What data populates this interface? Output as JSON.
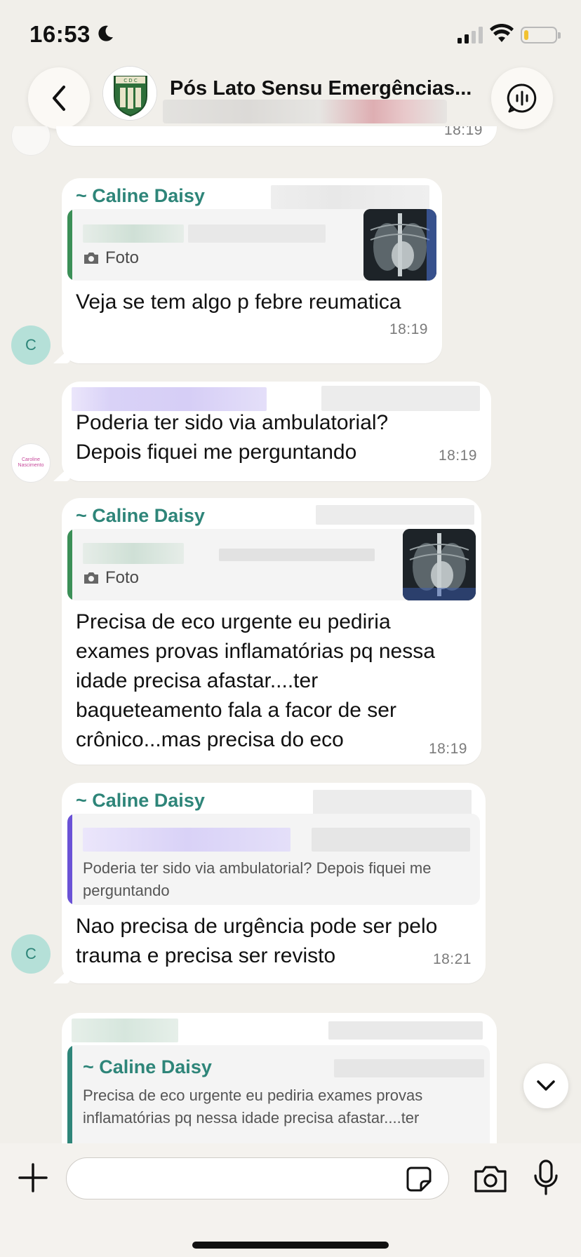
{
  "status_bar": {
    "time": "16:53"
  },
  "header": {
    "title": "Pós Lato Sensu Emergências..."
  },
  "chat": {
    "prev_time": "18:19",
    "messages": [
      {
        "sender": "~ Caline Daisy",
        "quote_label": "Foto",
        "text": "Veja se tem algo p febre reumatica",
        "time": "18:19",
        "avatar_letter": "C"
      },
      {
        "text_line1": "Poderia ter sido via ambulatorial?",
        "text_line2": "Depois fiquei me perguntando",
        "time": "18:19"
      },
      {
        "sender": "~ Caline Daisy",
        "quote_label": "Foto",
        "text": "Precisa de eco urgente eu pediria exames provas inflamatórias pq nessa idade precisa afastar....ter baqueteamento fala a facor de ser crônico...mas precisa do eco",
        "time": "18:19"
      },
      {
        "sender": "~ Caline Daisy",
        "quote_text": "Poderia ter sido via ambulatorial? Depois fiquei me perguntando",
        "text": "Nao precisa de urgência pode ser pelo trauma e precisa ser revisto",
        "time": "18:21",
        "avatar_letter": "C"
      },
      {
        "quote_sender": "~ Caline Daisy",
        "quote_text": "Precisa de eco urgente eu pediria exames provas inflamatórias pq nessa idade precisa afastar....ter"
      }
    ]
  },
  "input": {
    "placeholder": ""
  },
  "colors": {
    "accent_green": "#2e8579",
    "purple_bar": "#6a52d6",
    "bg": "#f1efea"
  }
}
